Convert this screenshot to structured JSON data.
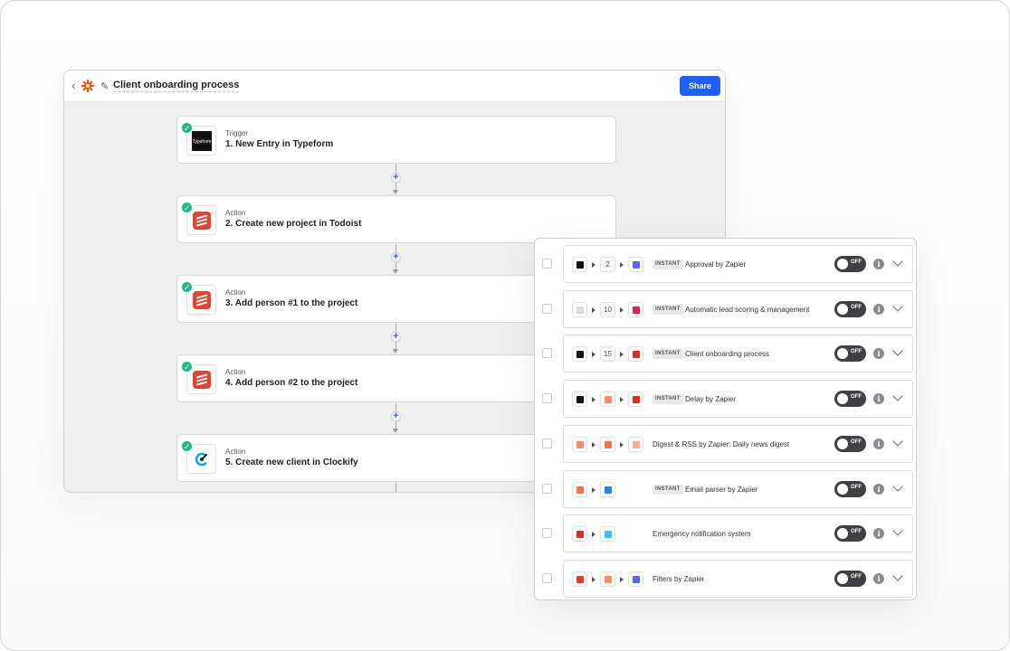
{
  "editor": {
    "title": "Client onboarding process",
    "share_label": "Share",
    "back_glyph": "‹",
    "pencil_glyph": "✎",
    "steps": [
      {
        "kind": "Trigger",
        "title": "1. New Entry in Typeform",
        "icon": "typeform",
        "icon_text": "Typeform"
      },
      {
        "kind": "Action",
        "title": "2. Create new project in Todoist",
        "icon": "todoist"
      },
      {
        "kind": "Action",
        "title": "3. Add person #1 to the project",
        "icon": "todoist"
      },
      {
        "kind": "Action",
        "title": "4. Add person #2 to the project",
        "icon": "todoist"
      },
      {
        "kind": "Action",
        "title": "5. Create new client in Clockify",
        "icon": "clockify"
      }
    ]
  },
  "zaps": [
    {
      "apps": [
        "#111111",
        "#5865f2"
      ],
      "count": "2",
      "instant": true,
      "name": "Approval by Zapier",
      "toggle": "OFF"
    },
    {
      "apps": [
        "#dddddd",
        "#e01e5a"
      ],
      "count": "10",
      "instant": true,
      "name": "Automatic lead scoring & management",
      "toggle": "OFF"
    },
    {
      "apps": [
        "#111111",
        "#d93025"
      ],
      "count": "15",
      "instant": true,
      "name": "Client onboarding process",
      "toggle": "OFF"
    },
    {
      "apps": [
        "#111111",
        "#ff8a65",
        "#d93025"
      ],
      "count": "",
      "instant": true,
      "name": "Delay by Zapier",
      "toggle": "OFF"
    },
    {
      "apps": [
        "#ff8a65",
        "#ff7043",
        "#ffab91"
      ],
      "count": "",
      "instant": false,
      "name": "Digest & RSS by Zapier: Daily news digest",
      "toggle": "OFF"
    },
    {
      "apps": [
        "#ff7043",
        "#1e88e5"
      ],
      "count": "",
      "instant": true,
      "name": "Email parser by Zapier",
      "toggle": "OFF"
    },
    {
      "apps": [
        "#d93025",
        "#36c5f0"
      ],
      "count": "",
      "instant": false,
      "name": "Emergency notification system",
      "toggle": "OFF"
    },
    {
      "apps": [
        "#e53935",
        "#ff8a65",
        "#5865f2"
      ],
      "count": "",
      "instant": false,
      "name": "Filters by Zapier",
      "toggle": "OFF"
    }
  ],
  "instant_label": "INSTANT",
  "colors": {
    "accent": "#1f5eff",
    "check": "#1cb98a",
    "todoist": "#e44332",
    "clockify": "#03a9f4",
    "zapier_orange": "#ff4a00"
  }
}
